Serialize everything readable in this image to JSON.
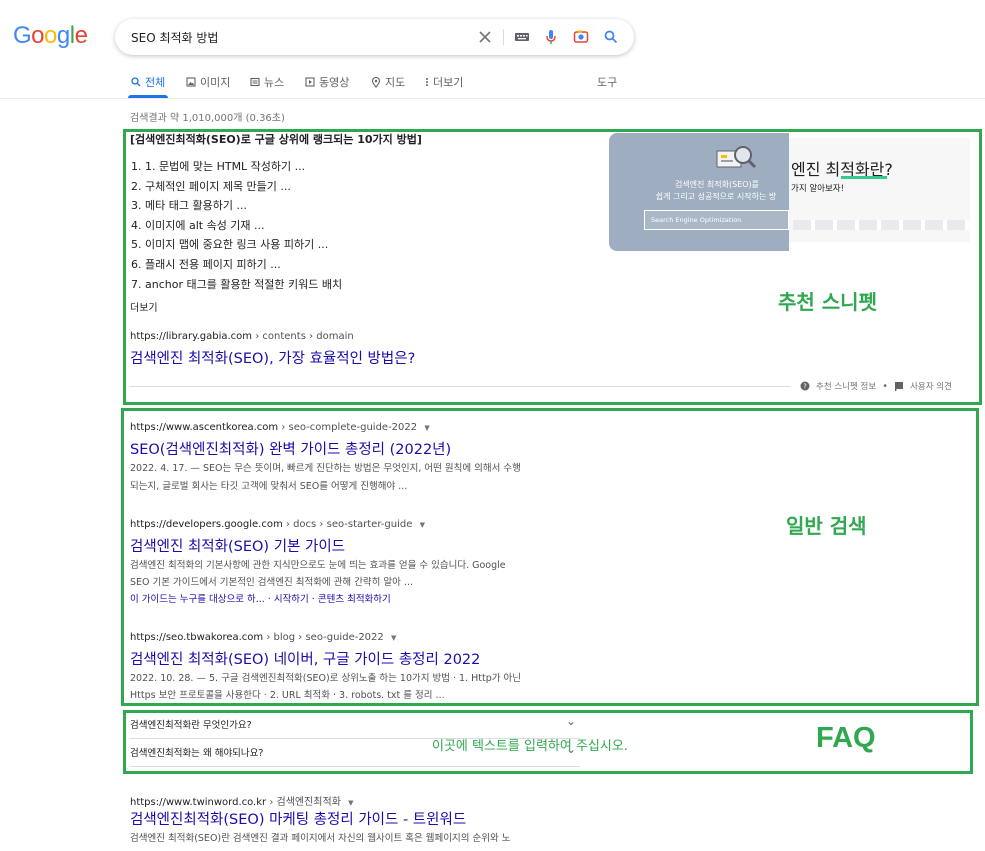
{
  "logo": {
    "letters": [
      "G",
      "o",
      "o",
      "g",
      "l",
      "e"
    ],
    "colors": [
      "#4285f4",
      "#ea4335",
      "#fbbc05",
      "#4285f4",
      "#34a853",
      "#ea4335"
    ]
  },
  "search": {
    "query": "SEO 최적화 방법"
  },
  "tabs": [
    {
      "label": "전체",
      "icon": "search-icon"
    },
    {
      "label": "이미지",
      "icon": "image-icon"
    },
    {
      "label": "뉴스",
      "icon": "news-icon"
    },
    {
      "label": "동영상",
      "icon": "video-icon"
    },
    {
      "label": "지도",
      "icon": "map-pin-icon"
    },
    {
      "label": "더보기",
      "icon": "more-vert-icon"
    }
  ],
  "tools_label": "도구",
  "stats": "검색결과 약 1,010,000개 (0.36초)",
  "featured": {
    "title": "[검색엔진최적화(SEO)로 구글 상위에 랭크되는 10가지 방법]",
    "items": [
      "1. 1. 문법에 맞는 HTML 작성하기 ...",
      "2. 구체적인 페이지 제목 만들기 ...",
      "3. 메타 태그 활용하기 ...",
      "4. 이미지에 alt 속성 기재 ...",
      "5. 이미지 맵에 중요한 링크 사용 피하기 ...",
      "6. 플래시 전용 페이지 피하기 ...",
      "7. anchor 태그를 활용한 적절한 키워드 배치"
    ],
    "more": "더보기",
    "url": "https://library.gabia.com",
    "breadcrumb": " › contents › domain",
    "link_title": "검색엔진 최적화(SEO), 가장 효율적인 방법은?",
    "image1": {
      "line1": "검색엔진 최적화(SEO)를",
      "line2": "쉽게 그리고 성공적으로 시작하는 방",
      "input": "Search Engine Optimization"
    },
    "image2": {
      "line1": "엔진 최적화란?",
      "line2": "가지 알아보자!"
    },
    "footer_info": "추천 스니펫 정보",
    "footer_feedback": "사용자 의견",
    "annotation": "추천 스니펫"
  },
  "results": [
    {
      "url": "https://www.ascentkorea.com",
      "breadcrumb": " › seo-complete-guide-2022",
      "title": "SEO(검색엔진최적화) 완벽 가이드 총정리 (2022년)",
      "snippet1": "2022. 4. 17. — SEO는 무슨 뜻이며, 빠르게 진단하는 방법은 무엇인지, 어떤 원칙에 의해서 수행",
      "snippet2": "되는지, 글로벌 회사는 타깃 고객에 맞춰서 SEO를 어떻게 진행해야 ..."
    },
    {
      "url": "https://developers.google.com",
      "breadcrumb": " › docs › seo-starter-guide",
      "title": "검색엔진 최적화(SEO) 기본 가이드",
      "snippet1": "검색엔진 최적화의 기본사항에 관한 지식만으로도 눈에 띄는 효과를 얻을 수 있습니다. Google",
      "snippet2": "SEO 기본 가이드에서 기본적인 검색엔진 최적화에 관해 간략히 알아 ...",
      "sitelinks": "이 가이드는 누구를 대상으로 하... · 시작하기 · 콘텐츠 최적화하기"
    },
    {
      "url": "https://seo.tbwakorea.com",
      "breadcrumb": " › blog › seo-guide-2022",
      "title": "검색엔진 최적화(SEO) 네이버, 구글 가이드 총정리 2022",
      "snippet1": "2022. 10. 28. — 5. 구글 검색엔진최적화(SEO)로 상위노출 하는 10가지 방법 · 1. Http가 아닌",
      "snippet2": "Https 보안 프로토콜을 사용한다 · 2. URL 최적화 · 3. robots. txt 를 정리 ..."
    }
  ],
  "organic_annotation": "일반 검색",
  "faq": {
    "q1": "검색엔진최적화란 무엇인가요?",
    "q2": "검색엔진최적화는 왜 해야되나요?",
    "placeholder": "이곳에 텍스트를 입력하여 주십시오.",
    "annotation": "FAQ"
  },
  "last_result": {
    "url": "https://www.twinword.co.kr",
    "breadcrumb": " › 검색엔진최적화",
    "title": "검색엔진최적화(SEO) 마케팅 총정리 가이드 - 트윈워드",
    "snippet1": "검색엔진 최적화(SEO)란 검색엔진 결과 페이지에서 자신의 웹사이트 혹은 웹페이지의 순위와 노"
  },
  "colors": {
    "link": "#1a0dab",
    "accent": "#1a73e8",
    "annotation_green": "#2fa84f"
  }
}
